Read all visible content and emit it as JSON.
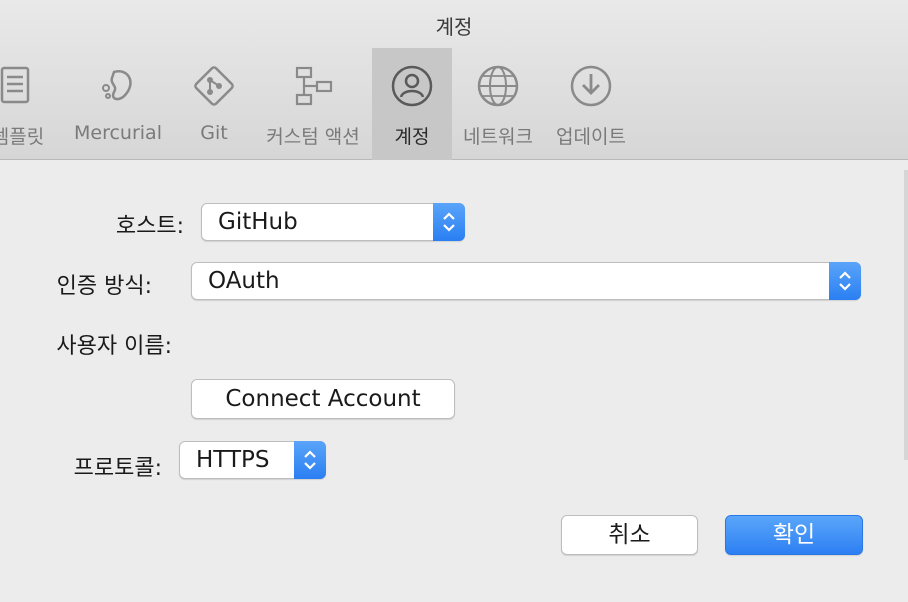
{
  "window": {
    "title": "계정"
  },
  "toolbar": {
    "items": [
      {
        "label": "템플릿",
        "icon": "template-icon",
        "selected": false
      },
      {
        "label": "Mercurial",
        "icon": "mercurial-icon",
        "selected": false
      },
      {
        "label": "Git",
        "icon": "git-icon",
        "selected": false
      },
      {
        "label": "커스텀 액션",
        "icon": "custom-actions-icon",
        "selected": false
      },
      {
        "label": "계정",
        "icon": "account-icon",
        "selected": true
      },
      {
        "label": "네트워크",
        "icon": "network-globe-icon",
        "selected": false
      },
      {
        "label": "업데이트",
        "icon": "update-download-icon",
        "selected": false
      }
    ]
  },
  "form": {
    "host_label": "호스트:",
    "host_value": "GitHub",
    "auth_label": "인증 방식:",
    "auth_value": "OAuth",
    "username_label": "사용자 이름:",
    "connect_button": "Connect Account",
    "protocol_label": "프로토콜:",
    "protocol_value": "HTTPS"
  },
  "actions": {
    "cancel": "취소",
    "ok": "확인"
  },
  "colors": {
    "accent": "#2d7ff3",
    "selected_tab": "#c7c7c7"
  }
}
